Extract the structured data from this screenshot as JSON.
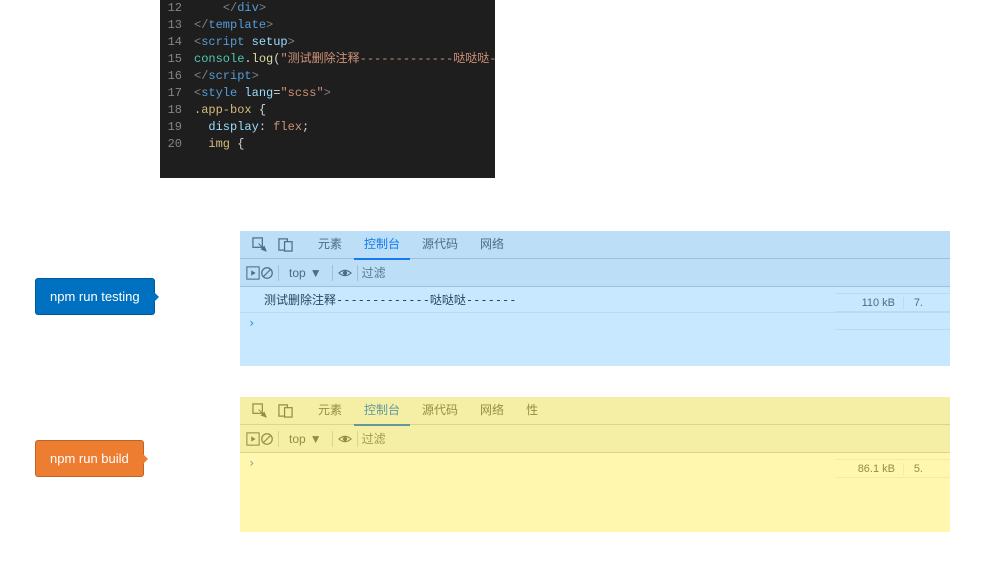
{
  "editor": {
    "lines": [
      {
        "num": "12",
        "html": "    </div>"
      },
      {
        "num": "13",
        "html": "</template>"
      },
      {
        "num": "14",
        "html": "<script setup>"
      },
      {
        "num": "15",
        "html": "console.log(\"测试删除注释-------------哒哒哒-------\");"
      },
      {
        "num": "16",
        "html": "</script>"
      },
      {
        "num": "17",
        "html": "<style lang=\"scss\">"
      },
      {
        "num": "18",
        "html": ".app-box {"
      },
      {
        "num": "19",
        "html": "  display: flex;"
      },
      {
        "num": "20",
        "html": "  img {"
      }
    ]
  },
  "callouts": {
    "testing": "npm run testing",
    "build": "npm run build"
  },
  "devtools_tabs": {
    "elements": "元素",
    "console": "控制台",
    "sources": "源代码",
    "network": "网络",
    "performance": "性"
  },
  "filterbar": {
    "top": "top",
    "filter_placeholder": "过滤"
  },
  "panel1": {
    "log": "测试删除注释-------------哒哒哒-------",
    "sizes": [
      {
        "size": "",
        "count": ""
      },
      {
        "size": "110 kB",
        "count": "7."
      },
      {
        "size": "",
        "count": ""
      }
    ]
  },
  "panel2": {
    "sizes": [
      {
        "size": "",
        "count": ""
      },
      {
        "size": "86.1 kB",
        "count": "5."
      }
    ]
  }
}
